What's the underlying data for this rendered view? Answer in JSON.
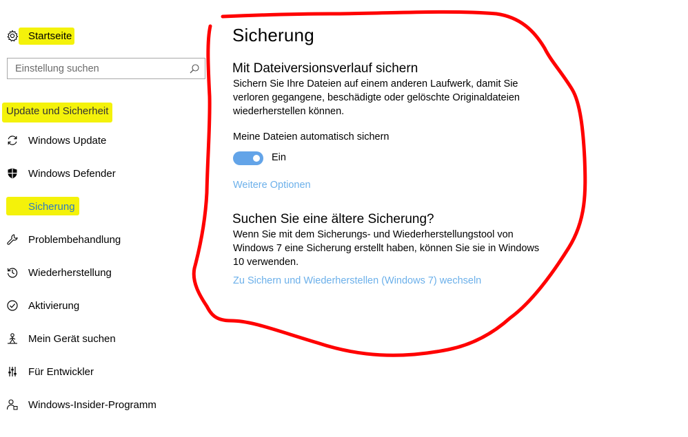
{
  "sidebar": {
    "home_label": "Startseite",
    "search": {
      "placeholder": "Einstellung suchen",
      "value": ""
    },
    "group_title": "Update und Sicherheit",
    "items": [
      {
        "label": "Windows Update",
        "icon": "refresh-icon"
      },
      {
        "label": "Windows Defender",
        "icon": "shield-icon"
      },
      {
        "label": "Sicherung",
        "icon": "upload-arrow-icon",
        "active": true
      },
      {
        "label": "Problembehandlung",
        "icon": "wrench-icon"
      },
      {
        "label": "Wiederherstellung",
        "icon": "history-icon"
      },
      {
        "label": "Aktivierung",
        "icon": "check-circle-icon"
      },
      {
        "label": "Mein Gerät suchen",
        "icon": "person-locate-icon"
      },
      {
        "label": "Für Entwickler",
        "icon": "developer-sliders-icon"
      },
      {
        "label": "Windows-Insider-Programm",
        "icon": "insider-person-icon"
      }
    ]
  },
  "main": {
    "title": "Sicherung",
    "file_history": {
      "heading": "Mit Dateiversionsverlauf sichern",
      "description": "Sichern Sie Ihre Dateien auf einem anderen Laufwerk, damit Sie verloren gegangene, beschädigte oder gelöschte Originaldateien wiederherstellen können.",
      "auto_backup_label": "Meine Dateien automatisch sichern",
      "toggle_state": "Ein",
      "toggle_on": true,
      "more_options_link": "Weitere Optionen"
    },
    "older_backup": {
      "heading": "Suchen Sie eine ältere Sicherung?",
      "description": "Wenn Sie mit dem Sicherungs- und Wiederherstellungstool von Windows 7 eine Sicherung erstellt haben, können Sie sie in Windows 10 verwenden.",
      "link": "Zu Sichern und Wiederherstellen (Windows 7) wechseln"
    }
  },
  "colors": {
    "accent": "#2a7bc4",
    "link": "#6cb0ea",
    "toggle": "#63a4e8",
    "highlight": "#f4f20a",
    "annotation": "#ff0000"
  }
}
